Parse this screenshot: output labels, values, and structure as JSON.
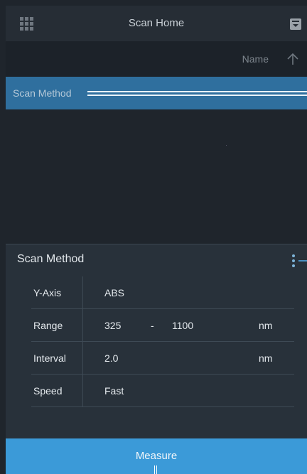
{
  "topbar": {
    "title": "Scan Home",
    "menu_icon": "grid-icon",
    "action_icon": "tray-icon"
  },
  "list_header": {
    "sort_label": "Name",
    "sort_icon": "arrow-up-icon"
  },
  "list": {
    "selected_item": "Scan Method"
  },
  "panel": {
    "title": "Scan Method",
    "menu_icon": "more-vertical-icon",
    "params": [
      {
        "key": "Y-Axis",
        "value": "ABS"
      },
      {
        "key": "Range",
        "value": "325",
        "separator": "-",
        "value_end": "1100",
        "unit": "nm"
      },
      {
        "key": "Interval",
        "value": "2.0",
        "unit": "nm"
      },
      {
        "key": "Speed",
        "value": "Fast"
      }
    ]
  },
  "footer": {
    "measure_label": "Measure"
  },
  "colors": {
    "accent": "#3b9ad8",
    "selected_row": "#2f6f9e",
    "background": "#1f252c",
    "panel": "#28313a"
  }
}
